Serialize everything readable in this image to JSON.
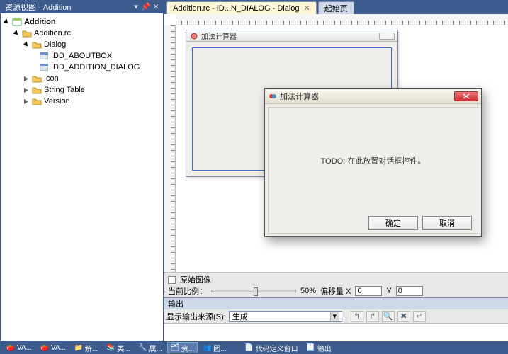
{
  "resource_view": {
    "title": "资源视图 - Addition",
    "tree": {
      "root": {
        "label": "Addition"
      },
      "rc": {
        "label": "Addition.rc"
      },
      "dialog_folder": {
        "label": "Dialog"
      },
      "dlg_about": {
        "label": "IDD_ABOUTBOX"
      },
      "dlg_main": {
        "label": "IDD_ADDITION_DIALOG"
      },
      "icon_folder": {
        "label": "Icon"
      },
      "string_folder": {
        "label": "String Table"
      },
      "version_folder": {
        "label": "Version"
      }
    }
  },
  "doc_tabs": {
    "active": {
      "label": "Addition.rc - ID...N_DIALOG - Dialog"
    },
    "start": {
      "label": "起始页"
    }
  },
  "design_dialog": {
    "title": "加法计算器"
  },
  "runtime_dialog": {
    "title": "加法计算器",
    "todo": "TODO: 在此放置对话框控件。",
    "ok": "确定",
    "cancel": "取消"
  },
  "zoom": {
    "check_label": "原始图像",
    "label_left": "当前比例：",
    "percent": "50%",
    "offset_label": "偏移量 X",
    "x": "0",
    "y_label": "Y",
    "y": "0"
  },
  "output": {
    "header": "输出",
    "source_label": "显示输出来源(S):",
    "source_value": "生成"
  },
  "taskbar": {
    "items": [
      {
        "label": "VA..."
      },
      {
        "label": "VA..."
      },
      {
        "label": "解..."
      },
      {
        "label": "类..."
      },
      {
        "label": "属..."
      },
      {
        "label": "资..."
      },
      {
        "label": "团..."
      },
      {
        "label": "代码定义窗口"
      },
      {
        "label": "输出"
      }
    ]
  }
}
